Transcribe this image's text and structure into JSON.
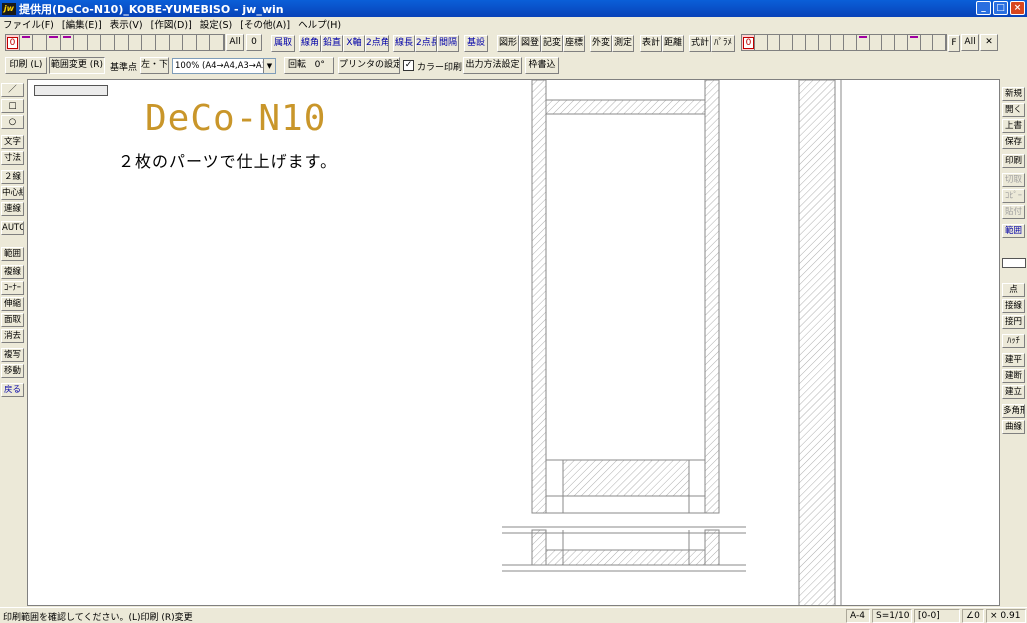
{
  "window": {
    "icon_text": "jw",
    "title": "提供用(DeCo-N10)_KOBE-YUMEBISO - jw_win",
    "controls": [
      "_",
      "□",
      "×"
    ]
  },
  "menu": [
    "ファイル(F)",
    "[編集(E)]",
    "表示(V)",
    "[作図(D)]",
    "設定(S)",
    "[その他(A)]",
    "ヘルプ(H)"
  ],
  "toolbar1": {
    "layer_group_zero": "0",
    "all_label": "All",
    "zero_label": "0",
    "buttons": [
      "属取",
      "線角",
      "鉛直",
      "X軸",
      "2点角",
      "線長",
      "2点長",
      "間隔",
      "基設",
      "図形",
      "図登",
      "記変",
      "座標",
      "外変",
      "測定",
      "表計",
      "距離",
      "式計",
      "ﾊﾟﾗﾒ"
    ],
    "right_layer_zero": "0",
    "right_f": "F",
    "right_all": "All",
    "right_x": "✕"
  },
  "toolbar2": {
    "print_btn": "印刷 (L)",
    "range_btn": "範囲変更 (R)",
    "base_label": "基準点",
    "base_btn": "左・下",
    "scale_select": "100% (A4→A4,A3→A3)",
    "rotate_btn": "回転",
    "rotate_value": "0°",
    "printer_btn": "プリンタの設定",
    "color_check": "✓",
    "color_label": "カラー印刷",
    "output_btn": "出力方法設定",
    "frame_btn": "枠書込"
  },
  "left_tools": [
    "／",
    "□",
    "○",
    "文字",
    "寸法",
    "２線",
    "中心線",
    "連線",
    "AUTO",
    "範囲",
    "複線",
    "ｺｰﾅｰ",
    "伸縮",
    "面取",
    "消去",
    "複写",
    "移動",
    "戻る"
  ],
  "right_tools": [
    "新規",
    "開く",
    "上書",
    "保存",
    "印刷",
    "切取",
    "ｺﾋﾟｰ",
    "貼付",
    "範囲",
    "点",
    "接線",
    "接円",
    "ﾊｯﾁ",
    "建平",
    "建断",
    "建立",
    "多角形",
    "曲線"
  ],
  "canvas": {
    "title": "DeCo-N10",
    "subtitle": "２枚のパーツで仕上げます。"
  },
  "status": {
    "message": "印刷範囲を確認してください。(L)印刷 (R)変更",
    "paper": "A-4",
    "scale": "S=1/10",
    "layer": "[0-0]",
    "angle": "∠0",
    "zoom": "× 0.91"
  },
  "colors": {
    "title_gold": "#c9962a",
    "titlebar_blue": "#0a5fd8",
    "button_blue": "#0000a8",
    "layer_mark": "#a000a0"
  }
}
